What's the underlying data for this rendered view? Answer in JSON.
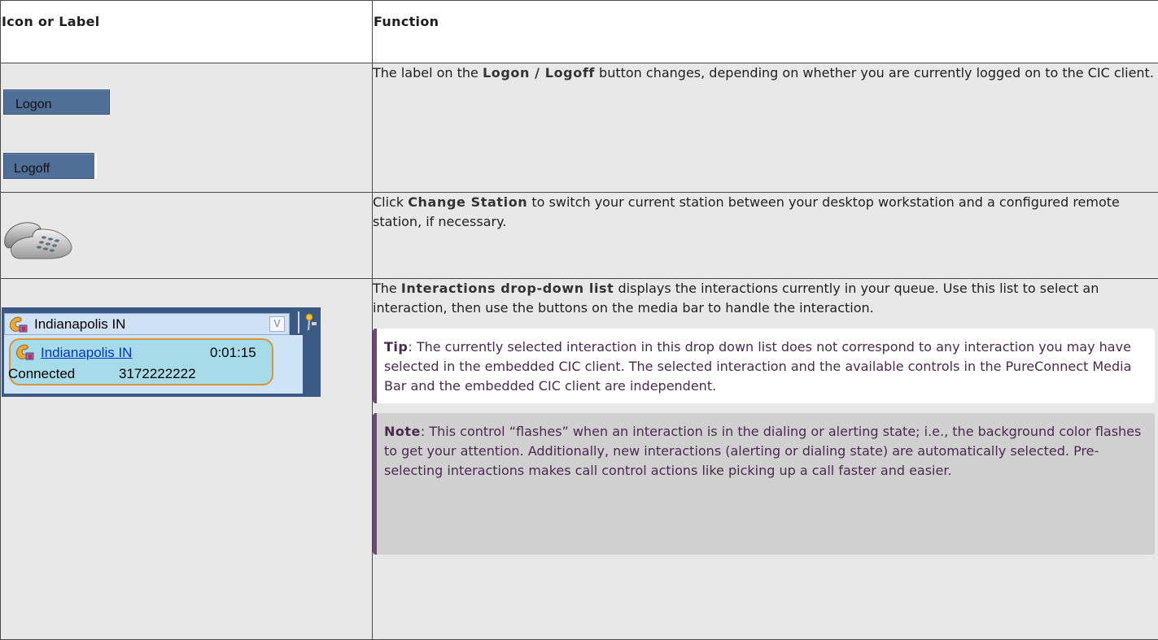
{
  "table": {
    "headers": {
      "icon": "Icon or Label",
      "function": "Function"
    },
    "rows": {
      "logon": {
        "logon_label": "Logon",
        "logoff_label": "Logoff",
        "text_before": "The label on the ",
        "term": "Logon / Logoff",
        "text_after": " button changes, depending on whether you are currently logged on to the CIC client."
      },
      "station": {
        "icon": "telephone-icon",
        "text_before": "Click ",
        "term": "Change Station",
        "text_after": " to switch your current station between your desktop workstation and a configured remote station, if necessary."
      },
      "interactions": {
        "dropdown_label": "Indianapolis IN",
        "dropdown_arrow": "V",
        "call_link": "Indianapolis IN",
        "call_time": "0:01:15",
        "call_state": "Connected",
        "call_number": "3172222222",
        "text_before": "The ",
        "term": "Interactions drop-down list",
        "text_after": " displays the interactions currently in your queue. Use this list to select an interaction, then use the buttons on the media bar to handle the interaction.",
        "tip_label": "Tip",
        "tip_text": ": The currently selected interaction in this drop down list does not correspond to any interaction you may have selected in the embedded CIC client. The selected interaction and the available controls in the PureConnect Media Bar and the embedded CIC client are independent.",
        "note_label": "Note",
        "note_text": ": This control “flashes” when an interaction is in the dialing or alerting state; i.e., the background color flashes to get your attention. Additionally, new interactions (alerting or dialing state) are automatically selected. Pre-selecting interactions makes call control actions like picking up a call faster and easier."
      }
    }
  },
  "colors": {
    "cell_bg": "#e8e8e8",
    "header_bg": "#ffffff",
    "callout_bar": "#6a4a72",
    "tip_bg": "#ffffff",
    "note_bg": "#d0d0d0",
    "button_bg": "#4f6f96",
    "call_card_bg": "#a6dcea",
    "call_card_border": "#d7963a"
  }
}
